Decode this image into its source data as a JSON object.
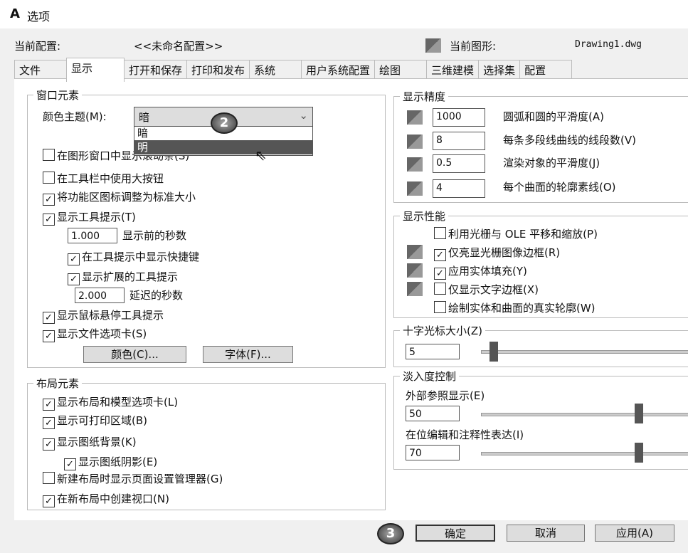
{
  "window": {
    "title": "选项",
    "app_icon": "A"
  },
  "header": {
    "profile_label": "当前配置:",
    "profile_value": "<<未命名配置>>",
    "drawing_label": "当前图形:",
    "drawing_value": "Drawing1.dwg"
  },
  "tabs": [
    "文件",
    "显示",
    "打开和保存",
    "打印和发布",
    "系统",
    "用户系统配置",
    "绘图",
    "三维建模",
    "选择集",
    "配置"
  ],
  "window_elements": {
    "title": "窗口元素",
    "theme_label": "颜色主题(M):",
    "theme_value": "暗",
    "theme_options": [
      "暗",
      "明"
    ],
    "scrollbars": "在图形窗口中显示滚动条(S)",
    "large_buttons": "在工具栏中使用大按钮",
    "ribbon_icons": "将功能区图标调整为标准大小",
    "tooltips": "显示工具提示(T)",
    "tooltip_delay_value": "1.000",
    "tooltip_delay_label": "显示前的秒数",
    "shortcut_keys": "在工具提示中显示快捷键",
    "extended_tooltips": "显示扩展的工具提示",
    "extended_delay_value": "2.000",
    "extended_delay_label": "延迟的秒数",
    "rollover_tooltips": "显示鼠标悬停工具提示",
    "file_tabs": "显示文件选项卡(S)",
    "colors_button": "颜色(C)...",
    "fonts_button": "字体(F)..."
  },
  "layout_elements": {
    "title": "布局元素",
    "layout_tabs": "显示布局和模型选项卡(L)",
    "printable_area": "显示可打印区域(B)",
    "paper_background": "显示图纸背景(K)",
    "paper_shadow": "显示图纸阴影(E)",
    "page_setup": "新建布局时显示页面设置管理器(G)",
    "create_viewport": "在新布局中创建视口(N)"
  },
  "display_resolution": {
    "title": "显示精度",
    "items": [
      {
        "value": "1000",
        "label": "圆弧和圆的平滑度(A)"
      },
      {
        "value": "8",
        "label": "每条多段线曲线的线段数(V)"
      },
      {
        "value": "0.5",
        "label": "渲染对象的平滑度(J)"
      },
      {
        "value": "4",
        "label": "每个曲面的轮廓素线(O)"
      }
    ]
  },
  "display_performance": {
    "title": "显示性能",
    "items": [
      {
        "label": "利用光栅与 OLE 平移和缩放(P)",
        "checked": false
      },
      {
        "label": "仅亮显光栅图像边框(R)",
        "checked": true
      },
      {
        "label": "应用实体填充(Y)",
        "checked": true
      },
      {
        "label": "仅显示文字边框(X)",
        "checked": false
      },
      {
        "label": "绘制实体和曲面的真实轮廓(W)",
        "checked": false
      }
    ]
  },
  "crosshair": {
    "title": "十字光标大小(Z)",
    "value": "5",
    "slider_percent": 5
  },
  "fade": {
    "title": "淡入度控制",
    "xref_label": "外部参照显示(E)",
    "xref_value": "50",
    "inplace_label": "在位编辑和注释性表达(I)",
    "inplace_value": "70"
  },
  "buttons": {
    "ok": "确定",
    "cancel": "取消",
    "apply": "应用(A)"
  },
  "badges": {
    "two": "2",
    "three": "3"
  },
  "check": "✓"
}
